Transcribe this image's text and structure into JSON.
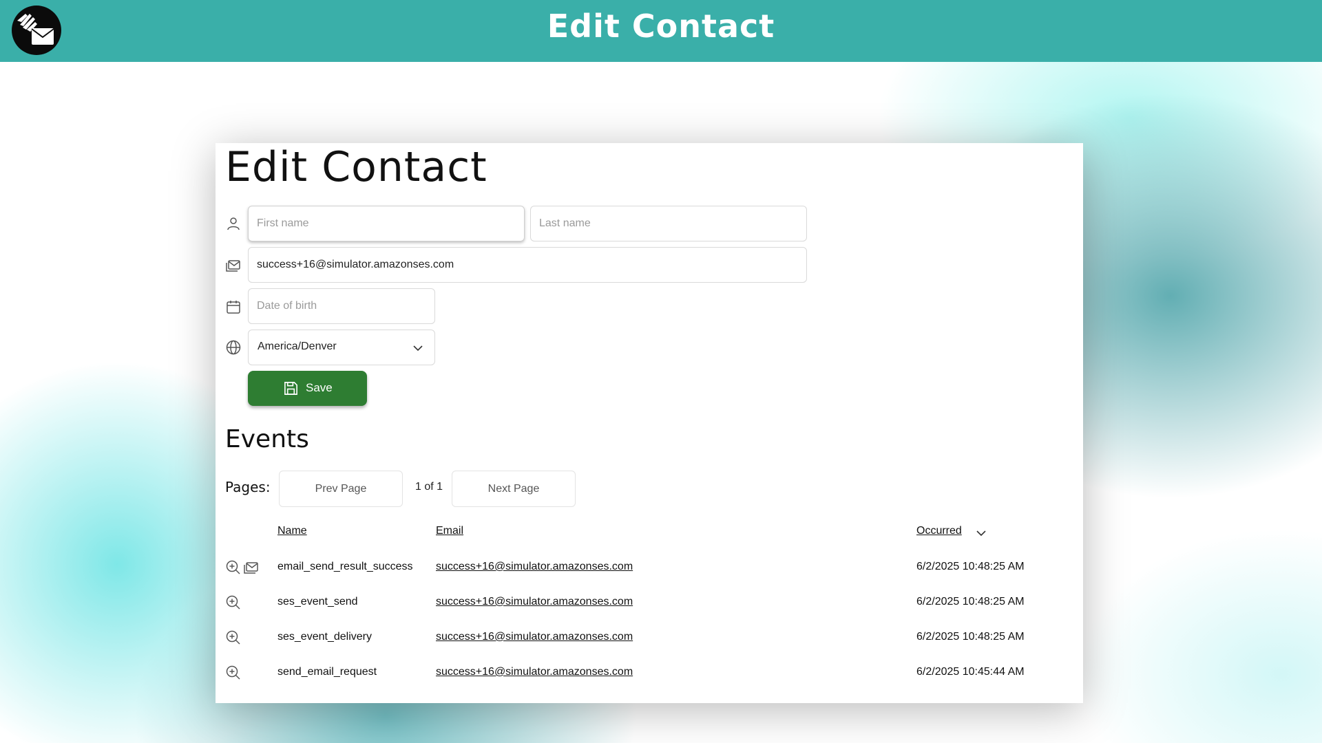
{
  "header": {
    "title": "Edit Contact"
  },
  "form": {
    "title": "Edit Contact",
    "first_name": {
      "value": "",
      "placeholder": "First name"
    },
    "last_name": {
      "value": "",
      "placeholder": "Last name"
    },
    "email": {
      "value": "success+16@simulator.amazonses.com",
      "placeholder": ""
    },
    "dob": {
      "value": "",
      "placeholder": "Date of birth"
    },
    "timezone": {
      "selected": "America/Denver"
    },
    "save_label": "Save"
  },
  "events": {
    "title": "Events",
    "pages_label": "Pages:",
    "prev_label": "Prev Page",
    "next_label": "Next Page",
    "page_count": "1 of 1",
    "columns": {
      "name": "Name",
      "email": "Email",
      "occurred": "Occurred"
    },
    "sort_icon": "chevron-down-icon",
    "rows": [
      {
        "name": "email_send_result_success",
        "email": "success+16@simulator.amazonses.com",
        "occurred": "6/2/2025 10:48:25 AM",
        "icons": [
          "zoom-in-icon",
          "mail-icon"
        ]
      },
      {
        "name": "ses_event_send",
        "email": "success+16@simulator.amazonses.com",
        "occurred": "6/2/2025 10:48:25 AM",
        "icons": [
          "zoom-in-icon"
        ]
      },
      {
        "name": "ses_event_delivery",
        "email": "success+16@simulator.amazonses.com",
        "occurred": "6/2/2025 10:48:25 AM",
        "icons": [
          "zoom-in-icon"
        ]
      },
      {
        "name": "send_email_request",
        "email": "success+16@simulator.amazonses.com",
        "occurred": "6/2/2025 10:45:44 AM",
        "icons": [
          "zoom-in-icon"
        ]
      }
    ]
  },
  "colors": {
    "header": "#3aafa9",
    "save_button": "#2e7d32",
    "icon": "#555555"
  }
}
